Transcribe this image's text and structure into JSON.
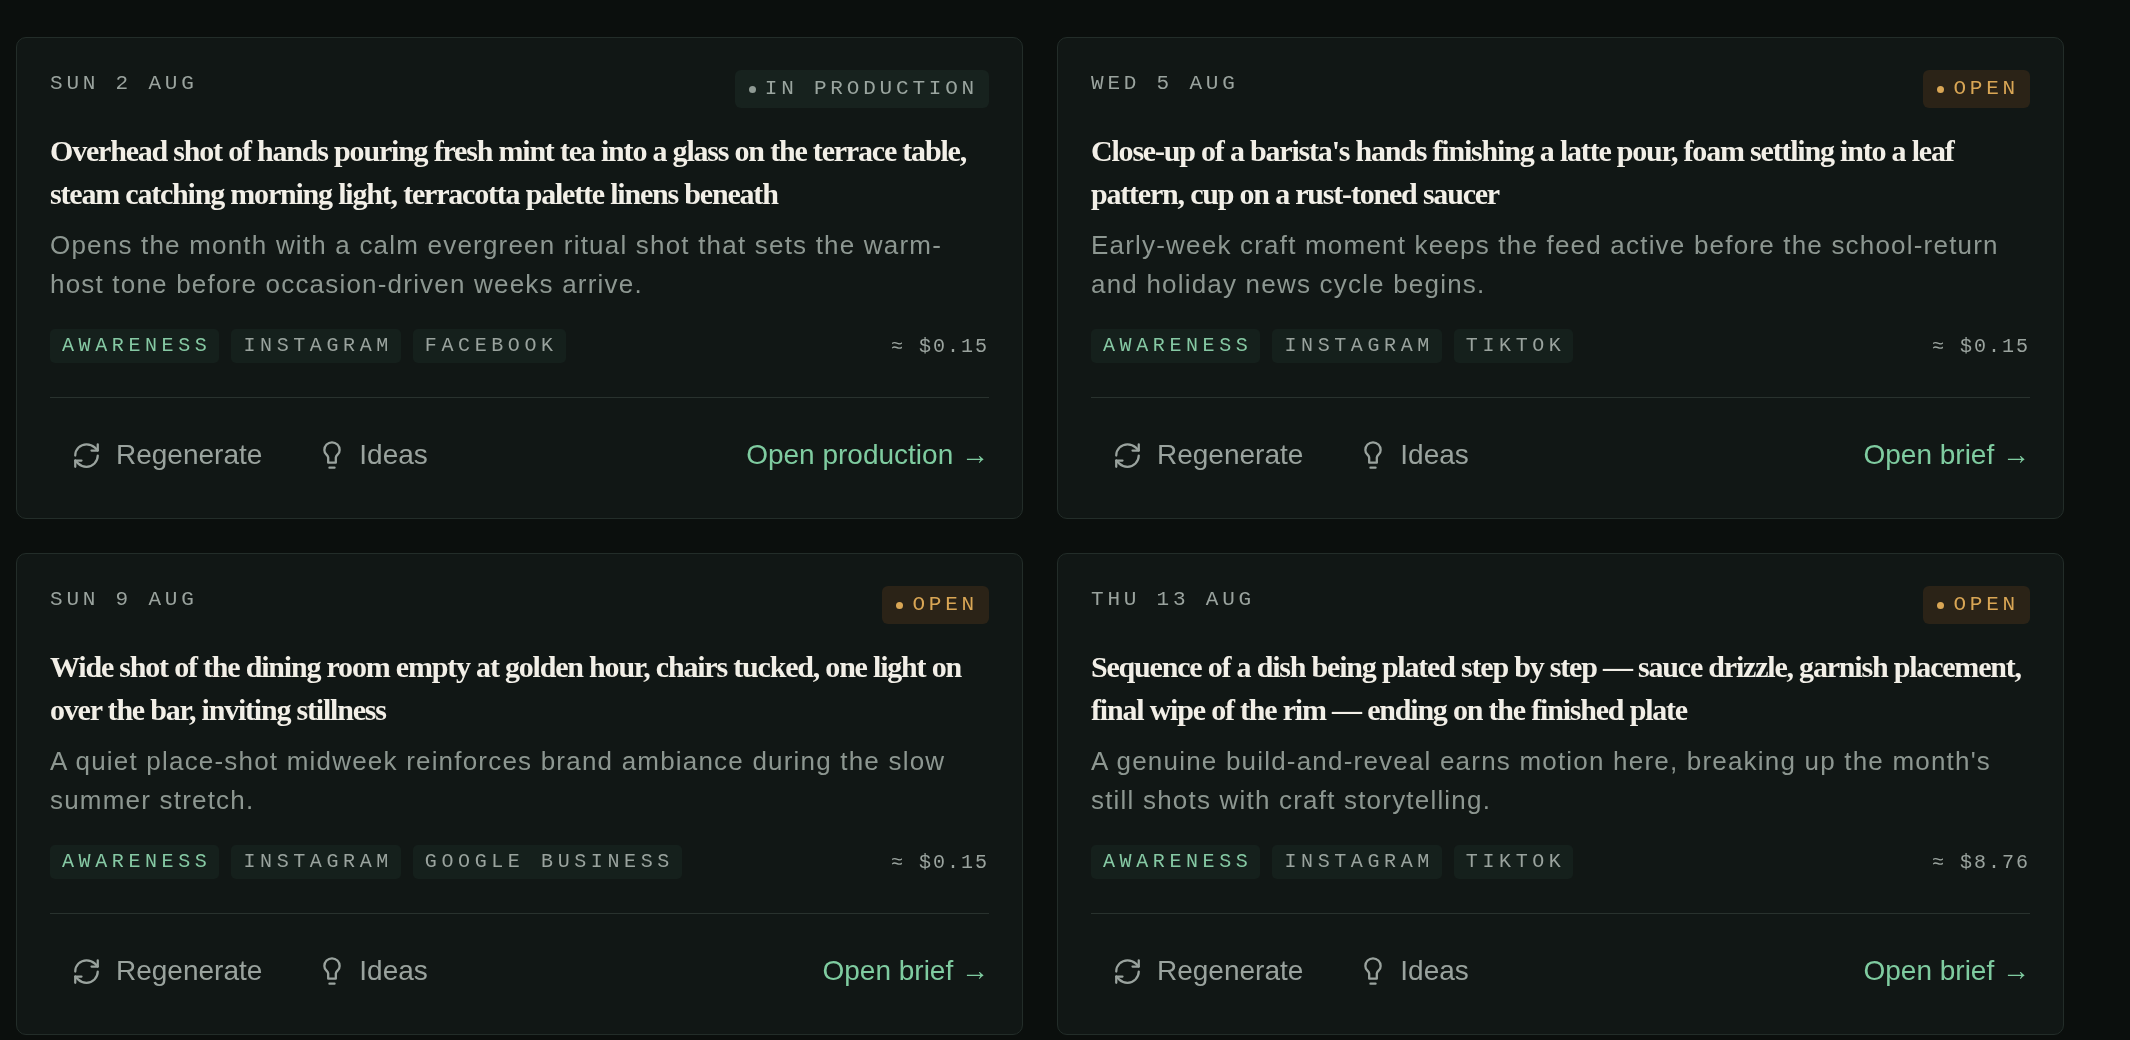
{
  "cards": [
    {
      "date": "SUN 2 AUG",
      "status": {
        "label": "IN PRODUCTION",
        "kind": "production"
      },
      "title": "Overhead shot of hands pouring fresh mint tea into a glass on the terrace table, steam catching morning light, terracotta palette linens beneath",
      "description": "Opens the month with a calm evergreen ritual shot that sets the warm-host tone before occasion-driven weeks arrive.",
      "tags": [
        {
          "label": "AWARENESS",
          "kind": "goal"
        },
        {
          "label": "INSTAGRAM",
          "kind": "channel"
        },
        {
          "label": "FACEBOOK",
          "kind": "channel"
        }
      ],
      "cost": "≈ $0.15",
      "actions": [
        {
          "label": "Regenerate",
          "kind": "regenerate"
        },
        {
          "label": "Ideas",
          "kind": "ideas"
        }
      ],
      "link": "Open production →"
    },
    {
      "date": "WED 5 AUG",
      "status": {
        "label": "OPEN",
        "kind": "open"
      },
      "title": "Close-up of a barista's hands finishing a latte pour, foam settling into a leaf pattern, cup on a rust-toned saucer",
      "description": "Early-week craft moment keeps the feed active before the school-return and holiday news cycle begins.",
      "tags": [
        {
          "label": "AWARENESS",
          "kind": "goal"
        },
        {
          "label": "INSTAGRAM",
          "kind": "channel"
        },
        {
          "label": "TIKTOK",
          "kind": "channel"
        }
      ],
      "cost": "≈ $0.15",
      "actions": [
        {
          "label": "Regenerate",
          "kind": "regenerate"
        },
        {
          "label": "Ideas",
          "kind": "ideas"
        }
      ],
      "link": "Open brief →"
    },
    {
      "date": "SUN 9 AUG",
      "status": {
        "label": "OPEN",
        "kind": "open"
      },
      "title": "Wide shot of the dining room empty at golden hour, chairs tucked, one light on over the bar, inviting stillness",
      "description": "A quiet place-shot midweek reinforces brand ambiance during the slow summer stretch.",
      "tags": [
        {
          "label": "AWARENESS",
          "kind": "goal"
        },
        {
          "label": "INSTAGRAM",
          "kind": "channel"
        },
        {
          "label": "GOOGLE BUSINESS",
          "kind": "channel"
        }
      ],
      "cost": "≈ $0.15",
      "actions": [
        {
          "label": "Regenerate",
          "kind": "regenerate"
        },
        {
          "label": "Ideas",
          "kind": "ideas"
        }
      ],
      "link": "Open brief →"
    },
    {
      "date": "THU 13 AUG",
      "status": {
        "label": "OPEN",
        "kind": "open"
      },
      "title": "Sequence of a dish being plated step by step — sauce drizzle, garnish placement, final wipe of the rim — ending on the finished plate",
      "description": "A genuine build-and-reveal earns motion here, breaking up the month's still shots with craft storytelling.",
      "tags": [
        {
          "label": "AWARENESS",
          "kind": "goal"
        },
        {
          "label": "INSTAGRAM",
          "kind": "channel"
        },
        {
          "label": "TIKTOK",
          "kind": "channel"
        }
      ],
      "cost": "≈ $8.76",
      "actions": [
        {
          "label": "Regenerate",
          "kind": "regenerate"
        },
        {
          "label": "Ideas",
          "kind": "ideas"
        }
      ],
      "link": "Open brief →"
    }
  ]
}
